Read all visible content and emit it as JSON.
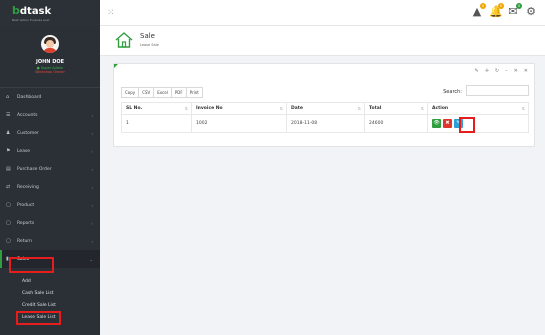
{
  "brand": {
    "logo_prefix": "b",
    "logo_rest": "dtask",
    "tagline": "Best option Purpose ever"
  },
  "user": {
    "name": "JOHN DOE",
    "status": "Super Admin",
    "warning": "Workshop Owner"
  },
  "sidebar": {
    "items": [
      {
        "label": "Dashboard",
        "icon": "⌂",
        "icon_name": "home-icon",
        "chevron": ""
      },
      {
        "label": "Accounts",
        "icon": "☰",
        "icon_name": "accounts-icon",
        "chevron": "‹"
      },
      {
        "label": "Customer",
        "icon": "♟",
        "icon_name": "user-icon",
        "chevron": "‹"
      },
      {
        "label": "Lease",
        "icon": "⚑",
        "icon_name": "lease-icon",
        "chevron": "‹"
      },
      {
        "label": "Purchase Order",
        "icon": "▤",
        "icon_name": "purchase-icon",
        "chevron": "‹"
      },
      {
        "label": "Receiving",
        "icon": "⇄",
        "icon_name": "receiving-icon",
        "chevron": "‹"
      },
      {
        "label": "Product",
        "icon": "▢",
        "icon_name": "product-icon",
        "chevron": "‹"
      },
      {
        "label": "Reports",
        "icon": "▢",
        "icon_name": "reports-icon",
        "chevron": "‹"
      },
      {
        "label": "Return",
        "icon": "▢",
        "icon_name": "return-icon",
        "chevron": "‹"
      },
      {
        "label": "Sales",
        "icon": "▮",
        "icon_name": "sales-icon",
        "chevron": "⌄"
      }
    ],
    "sub_items": [
      "Add",
      "Cash Sale List",
      "Credit Sale List",
      "Lease Sale List"
    ]
  },
  "topbar": {
    "grid_icon": "⁙",
    "icons": [
      {
        "name": "alert-icon",
        "glyph": "▲",
        "badge": "0",
        "badge_color": "#f0a500"
      },
      {
        "name": "bell-icon",
        "glyph": "🔔",
        "badge": "0",
        "badge_color": "#f0a500"
      },
      {
        "name": "mail-icon",
        "glyph": "✉",
        "badge": "0",
        "badge_color": "#2e9e3e"
      },
      {
        "name": "gear-icon",
        "glyph": "⚙",
        "badge": "",
        "badge_color": ""
      }
    ]
  },
  "page": {
    "title": "Sale",
    "subtitle": "Lease Sale"
  },
  "panel": {
    "tools": [
      "✎",
      "✛",
      "↻",
      "–",
      "✕",
      "✕"
    ],
    "buttons": [
      "Copy",
      "CSV",
      "Excel",
      "PDF",
      "Print"
    ],
    "search_label": "Search:",
    "search_value": "",
    "columns": [
      "SL No.",
      "Invoice No",
      "Date",
      "Total",
      "Action"
    ],
    "rows": [
      {
        "sl": "1",
        "invoice": "1002",
        "date": "2018-11-08",
        "total": "24600"
      }
    ],
    "actions": {
      "view": "👁",
      "delete": "✖",
      "edit": "✎"
    }
  },
  "colors": {
    "accent": "#2e9e3e",
    "highlight": "#e51d1d",
    "sidebar": "#2b2f36"
  }
}
